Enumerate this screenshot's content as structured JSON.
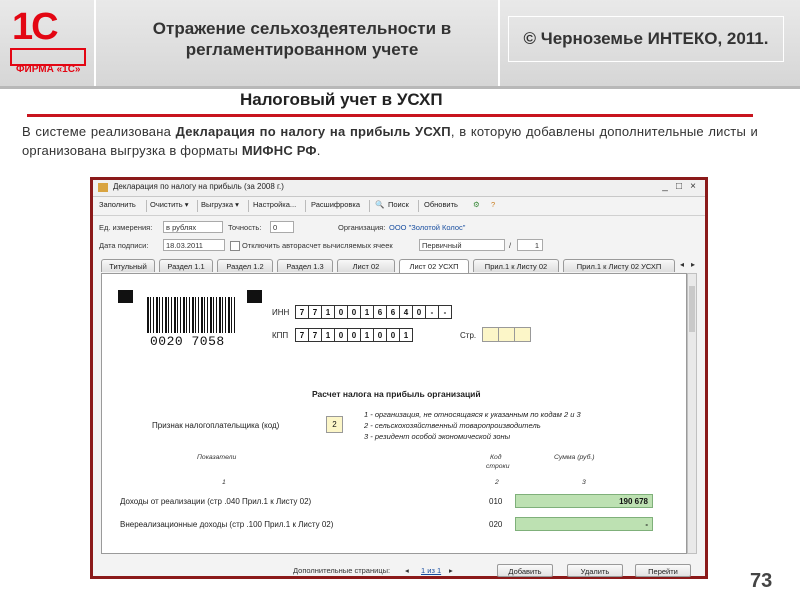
{
  "header": {
    "logo_text": "1С",
    "logo_firm": "ФИРМА «1С»",
    "title": "Отражение сельхоздеятельности в регламентированном учете",
    "copyright": "© Черноземье ИНТЕКО, 2011."
  },
  "subtitle": "Налоговый учет в УСХП",
  "description": {
    "part1": "В системе реализована ",
    "bold1": "Декларация по налогу на прибыль УСХП",
    "part2": ", в которую добавлены дополнительные листы и организована выгрузка в форматы ",
    "bold2": "МИФНС РФ",
    "part3": "."
  },
  "window": {
    "title": "Декларация по налогу на прибыль (за 2008 г.)",
    "controls": [
      "_",
      "□",
      "×"
    ],
    "toolbar": [
      "Заполнить",
      "Очистить ▾",
      "Выгрузка ▾",
      "Настройка...",
      "Расшифровка",
      "Поиск",
      "Обновить"
    ],
    "units_label": "Ед. измерения:",
    "units_value": "в рублях",
    "precision_label": "Точность:",
    "precision_value": "0",
    "org_label": "Организация:",
    "org_value": "ООО \"Золотой Колос\"",
    "date_label": "Дата подписи:",
    "date_value": "18.03.2011",
    "autocalc_label": "Отключить авторасчет вычисляемых ячеек",
    "kind_value": "Первичный",
    "slash": "/",
    "kind_num": "1",
    "tabs": [
      "Титульный",
      "Раздел 1.1",
      "Раздел 1.2",
      "Раздел 1.3",
      "Лист 02",
      "Лист 02 УСХП",
      "Прил.1 к Листу 02",
      "Прил.1 к Листу 02 УСХП"
    ],
    "active_tab": 5
  },
  "form": {
    "barcode_number": "0020 7058",
    "inn_label": "ИНН",
    "inn_digits": [
      "7",
      "7",
      "1",
      "0",
      "0",
      "1",
      "6",
      "6",
      "4",
      "0",
      "-",
      "-"
    ],
    "kpp_label": "КПП",
    "kpp_digits": [
      "7",
      "7",
      "1",
      "0",
      "0",
      "1",
      "0",
      "0",
      "1"
    ],
    "page_label": "Стр.",
    "title": "Расчет налога на прибыль организаций",
    "payer_label": "Признак налогоплательщика (код)",
    "payer_code": "2",
    "payer_options": [
      "1 - организация, не относящаяся к указанным по кодам 2 и 3",
      "2 - сельскохозяйственный товаропроизводитель",
      "3 - резидент особой экономической зоны"
    ],
    "col_indicators": "Показатели",
    "col_code_line1": "Код",
    "col_code_line2": "строки",
    "col_sum": "Сумма (руб.)",
    "col_n1": "1",
    "col_n2": "2",
    "col_n3": "3",
    "rows": [
      {
        "label": "Доходы от реализации (стр .040 Прил.1 к Листу 02)",
        "code": "010",
        "value": "190 678"
      },
      {
        "label": "Внереализационные доходы (стр .100 Прил.1 к Листу 02)",
        "code": "020",
        "value": "-"
      }
    ]
  },
  "bottombar": {
    "extra_pages_label": "Дополнительные страницы:",
    "page_nav": "1 из 1",
    "add": "Добавить",
    "delete": "Удалить",
    "goto": "Перейти"
  },
  "slide_number": "73"
}
